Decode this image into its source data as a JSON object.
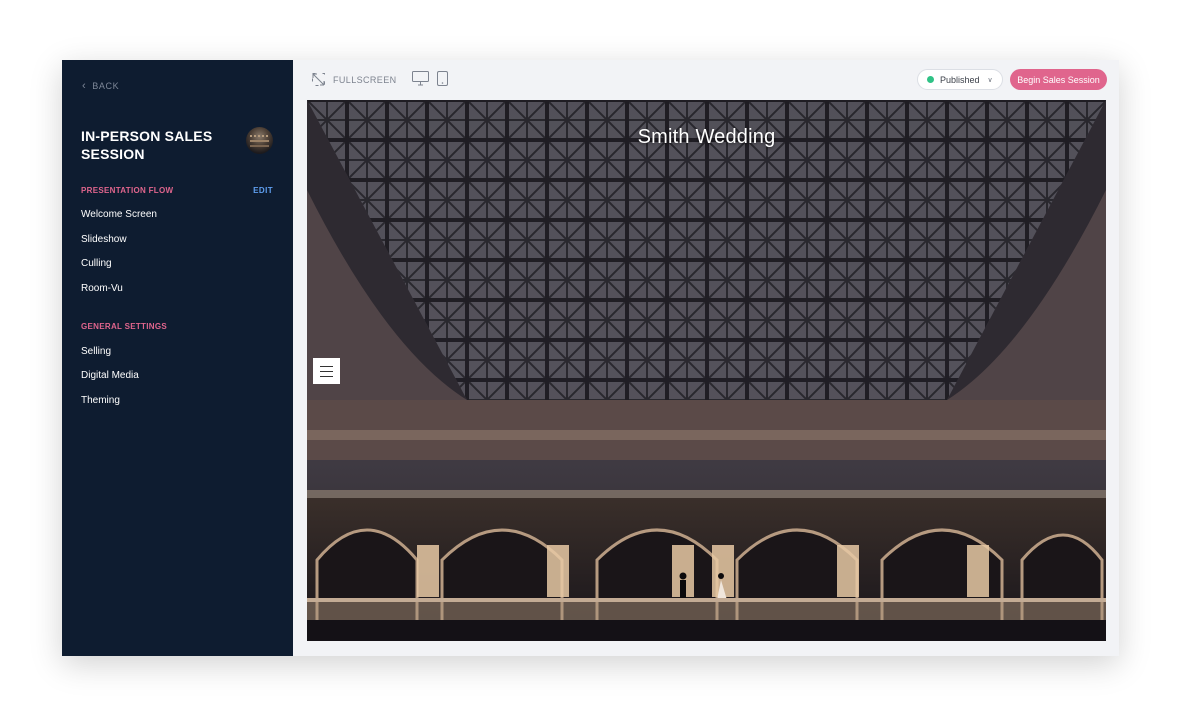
{
  "sidebar": {
    "back_label": "BACK",
    "title": "IN-PERSON SALES SESSION",
    "sections": [
      {
        "label": "PRESENTATION FLOW",
        "action": "EDIT",
        "items": [
          {
            "label": "Welcome Screen"
          },
          {
            "label": "Slideshow"
          },
          {
            "label": "Culling"
          },
          {
            "label": "Room-Vu"
          }
        ]
      },
      {
        "label": "GENERAL SETTINGS",
        "items": [
          {
            "label": "Selling"
          },
          {
            "label": "Digital Media"
          },
          {
            "label": "Theming"
          }
        ]
      }
    ]
  },
  "topbar": {
    "fullscreen_label": "FULLSCREEN",
    "devices": [
      "desktop-icon",
      "tablet-icon"
    ],
    "status": {
      "label": "Published",
      "color": "#2fc286"
    },
    "primary_action": "Begin Sales Session"
  },
  "preview": {
    "title": "Smith Wedding",
    "menu_icon": "hamburger-menu-icon"
  },
  "colors": {
    "sidebar_bg": "#0e1c30",
    "accent_pink": "#e0658d",
    "link_blue": "#5f9ff0",
    "app_bg": "#f2f3f6"
  }
}
